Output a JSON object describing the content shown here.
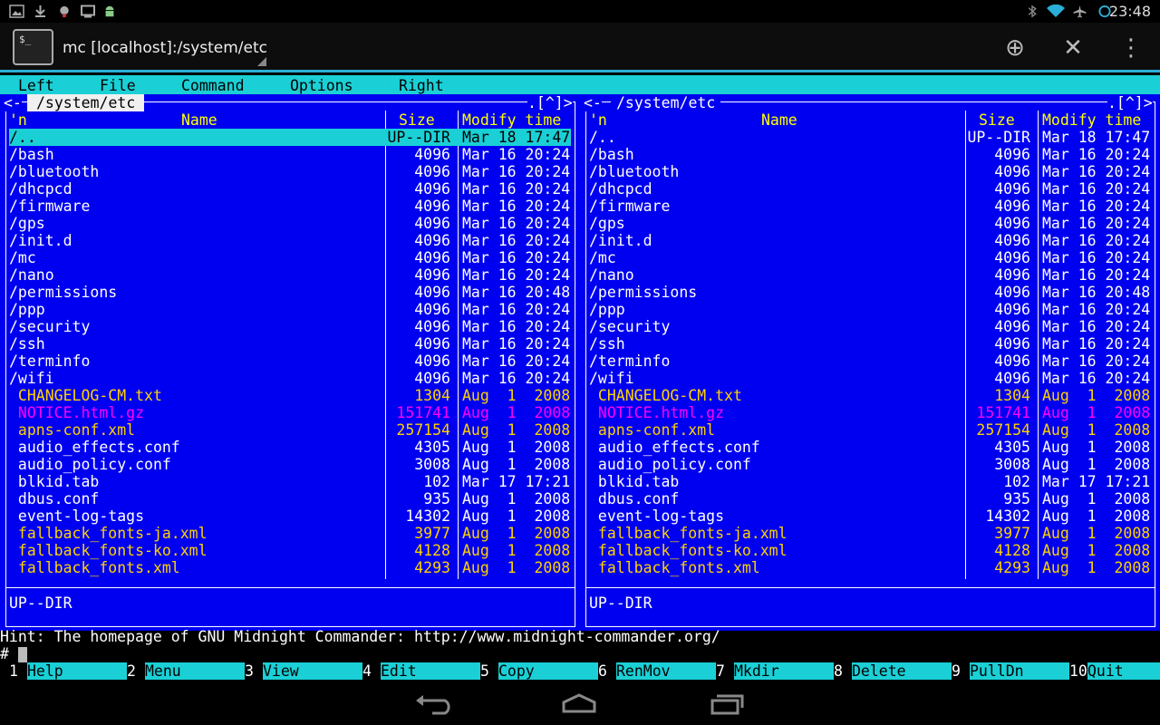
{
  "status": {
    "time": "23:48"
  },
  "app": {
    "title": "mc [localhost]:/system/etc",
    "icon_text": "$_"
  },
  "menubar": [
    "Left",
    "File",
    "Command",
    "Options",
    "Right"
  ],
  "panels": [
    {
      "path": "/system/etc",
      "corner_left": "<-",
      "corner_right": ".[^]>",
      "headers": {
        "n": "'n",
        "name": "Name",
        "size": "Size",
        "modify": "Modify time"
      },
      "ministatus": "UP--DIR"
    },
    {
      "path": "/system/etc",
      "corner_left": "<-",
      "corner_right": ".[^]>",
      "headers": {
        "n": "'n",
        "name": "Name",
        "size": "Size",
        "modify": "Modify time"
      },
      "ministatus": "UP--DIR"
    }
  ],
  "files": [
    {
      "name": "/..",
      "size": "UP--DIR",
      "date": "Mar 18 17:47",
      "type": "dir"
    },
    {
      "name": "/bash",
      "size": "4096",
      "date": "Mar 16 20:24",
      "type": "dir"
    },
    {
      "name": "/bluetooth",
      "size": "4096",
      "date": "Mar 16 20:24",
      "type": "dir"
    },
    {
      "name": "/dhcpcd",
      "size": "4096",
      "date": "Mar 16 20:24",
      "type": "dir"
    },
    {
      "name": "/firmware",
      "size": "4096",
      "date": "Mar 16 20:24",
      "type": "dir"
    },
    {
      "name": "/gps",
      "size": "4096",
      "date": "Mar 16 20:24",
      "type": "dir"
    },
    {
      "name": "/init.d",
      "size": "4096",
      "date": "Mar 16 20:24",
      "type": "dir"
    },
    {
      "name": "/mc",
      "size": "4096",
      "date": "Mar 16 20:24",
      "type": "dir"
    },
    {
      "name": "/nano",
      "size": "4096",
      "date": "Mar 16 20:24",
      "type": "dir"
    },
    {
      "name": "/permissions",
      "size": "4096",
      "date": "Mar 16 20:48",
      "type": "dir"
    },
    {
      "name": "/ppp",
      "size": "4096",
      "date": "Mar 16 20:24",
      "type": "dir"
    },
    {
      "name": "/security",
      "size": "4096",
      "date": "Mar 16 20:24",
      "type": "dir"
    },
    {
      "name": "/ssh",
      "size": "4096",
      "date": "Mar 16 20:24",
      "type": "dir"
    },
    {
      "name": "/terminfo",
      "size": "4096",
      "date": "Mar 16 20:24",
      "type": "dir"
    },
    {
      "name": "/wifi",
      "size": "4096",
      "date": "Mar 16 20:24",
      "type": "dir"
    },
    {
      "name": " CHANGELOG-CM.txt",
      "size": "1304",
      "date": "Aug  1  2008",
      "type": "file"
    },
    {
      "name": " NOTICE.html.gz",
      "size": "151741",
      "date": "Aug  1  2008",
      "type": "arch"
    },
    {
      "name": " apns-conf.xml",
      "size": "257154",
      "date": "Aug  1  2008",
      "type": "file"
    },
    {
      "name": " audio_effects.conf",
      "size": "4305",
      "date": "Aug  1  2008",
      "type": "plain"
    },
    {
      "name": " audio_policy.conf",
      "size": "3008",
      "date": "Aug  1  2008",
      "type": "plain"
    },
    {
      "name": " blkid.tab",
      "size": "102",
      "date": "Mar 17 17:21",
      "type": "plain"
    },
    {
      "name": " dbus.conf",
      "size": "935",
      "date": "Aug  1  2008",
      "type": "plain"
    },
    {
      "name": " event-log-tags",
      "size": "14302",
      "date": "Aug  1  2008",
      "type": "plain"
    },
    {
      "name": " fallback_fonts-ja.xml",
      "size": "3977",
      "date": "Aug  1  2008",
      "type": "file"
    },
    {
      "name": " fallback_fonts-ko.xml",
      "size": "4128",
      "date": "Aug  1  2008",
      "type": "file"
    },
    {
      "name": " fallback_fonts.xml",
      "size": "4293",
      "date": "Aug  1  2008",
      "type": "file"
    }
  ],
  "hint": "Hint: The homepage of GNU Midnight Commander: http://www.midnight-commander.org/",
  "prompt": "#",
  "fkeys": [
    {
      "num": "1",
      "label": "Help"
    },
    {
      "num": "2",
      "label": "Menu"
    },
    {
      "num": "3",
      "label": "View"
    },
    {
      "num": "4",
      "label": "Edit"
    },
    {
      "num": "5",
      "label": "Copy"
    },
    {
      "num": "6",
      "label": "RenMov"
    },
    {
      "num": "7",
      "label": "Mkdir"
    },
    {
      "num": "8",
      "label": "Delete"
    },
    {
      "num": "9",
      "label": "PullDn"
    },
    {
      "num": "10",
      "label": "Quit"
    }
  ],
  "icons": {
    "status_left": [
      "gallery-icon",
      "download-icon",
      "android-debug-icon",
      "screen-icon",
      "android-icon"
    ],
    "status_right": [
      "bluetooth-icon",
      "wifi-icon",
      "airplane-icon",
      "sync-icon"
    ],
    "actions": [
      "add-icon",
      "close-icon",
      "overflow-menu-icon"
    ],
    "nav": [
      "back-icon",
      "home-icon",
      "recent-apps-icon"
    ]
  },
  "colors": {
    "panel": "#0000f0",
    "accent": "#1ad0d6",
    "selected": "#1ad0d6",
    "file_yellow": "#ffd200",
    "archive_magenta": "#ff00ff"
  }
}
